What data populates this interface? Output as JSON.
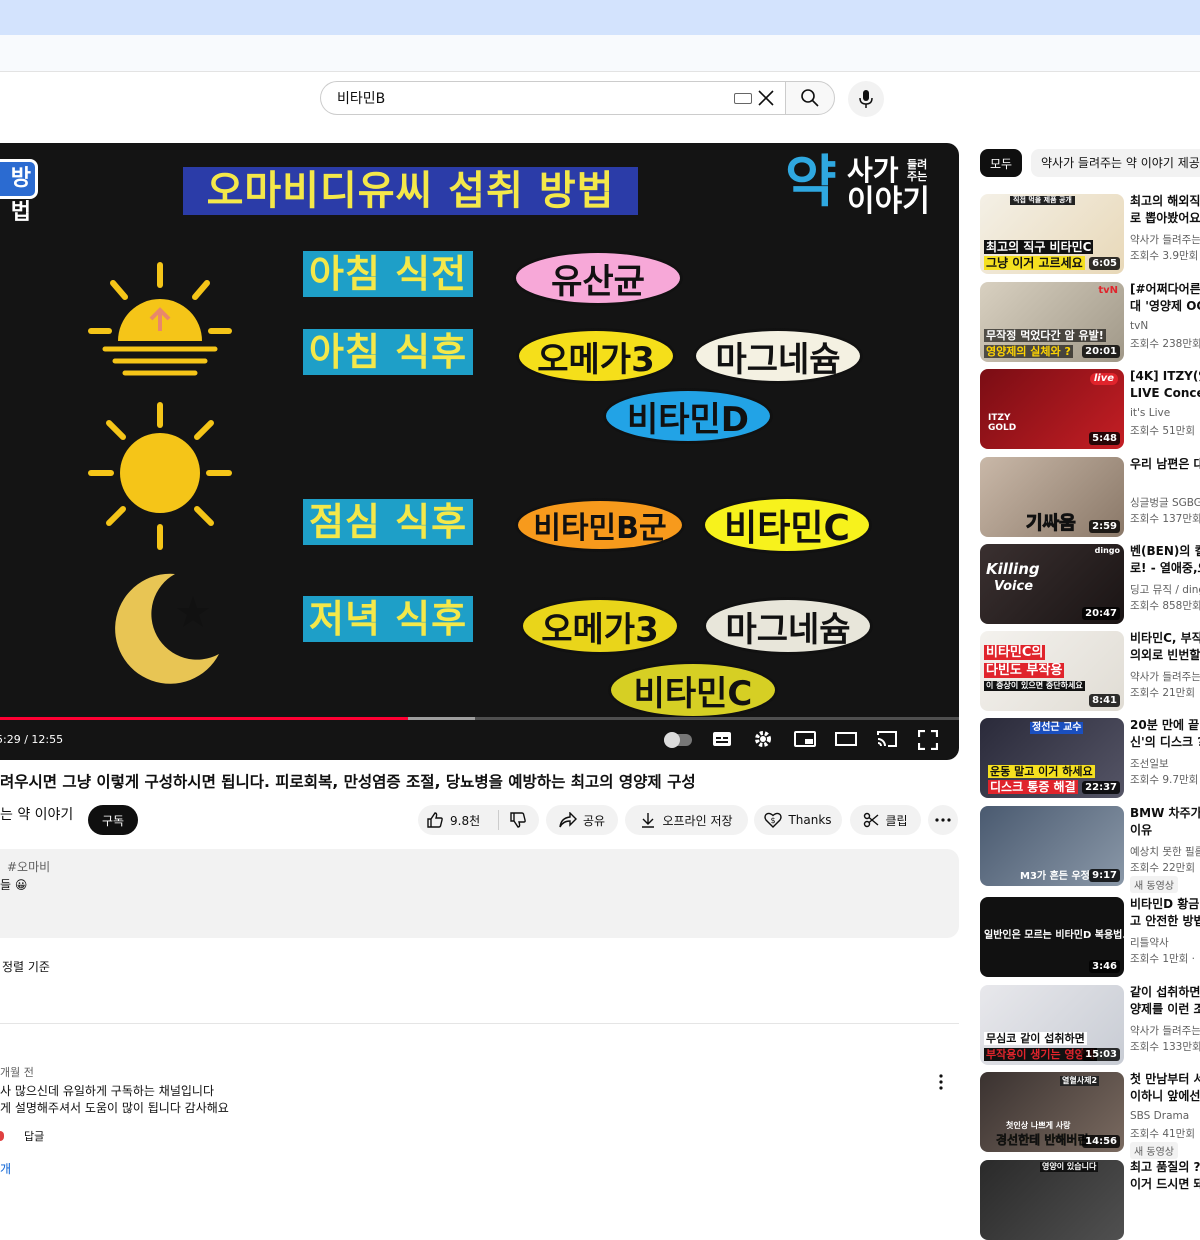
{
  "search": {
    "query": "비타민B"
  },
  "video": {
    "slide_title": "오마비디유씨 섭취 방법",
    "slide_corner": "방법",
    "logo_big": "약",
    "logo_line1": "사가",
    "logo_line1_small": "들려주는",
    "logo_line2": "이야기",
    "meals": [
      "아침 식전",
      "아침 식후",
      "점심 식후",
      "저녁 식후"
    ],
    "pills": {
      "probiotic": "유산균",
      "omega_1": "오메가3",
      "magnesium_1": "마그네슘",
      "vitamin_d": "비타민D",
      "vitamin_b": "비타민B군",
      "vitamin_c_1": "비타민C",
      "omega_2": "오메가3",
      "magnesium_2": "마그네슘",
      "vitamin_c_2": "비타민C"
    },
    "time_display": "5:29 / 12:55",
    "progress_fraction": 0.425,
    "buffered_fraction": 0.495,
    "colors": {
      "probiotic": "#f7a8d8",
      "omega": "#f5df1a",
      "magnesium": "#f4f1e2",
      "vitamin_d": "#22a3e6",
      "vitamin_b": "#f79a1c",
      "vitamin_c": "#f7f21c",
      "omega_evening": "#e9d51a",
      "magnesium_evening": "#e8e6da",
      "vitamin_c_evening": "#d6cf24",
      "accent_red": "#ff0033"
    }
  },
  "title": "려우시면 그냥 이렇게 구성하시면 됩니다. 피로회복, 만성염증 조절, 당뇨병을 예방하는 최고의 영양제 구성",
  "channel": {
    "name": "는 약 이야기",
    "subscribe_label": "구독"
  },
  "actions": {
    "like_count": "9.8천",
    "share_label": "공유",
    "download_label": "오프라인 저장",
    "thanks_label": "Thanks",
    "clip_label": "클립"
  },
  "description": {
    "hashtag": "#오마비",
    "line": "들 😀"
  },
  "comments": {
    "sort_label": "정렬 기준",
    "item": {
      "time": "개월 전",
      "line1": "사 많으신데 유일하게 구독하는 채널입니다",
      "line2": "게 설명해주셔서 도움이 많이 됩니다 감사해요",
      "reply_label": "답글",
      "replies_count": "개"
    }
  },
  "sidebar": {
    "chip_all": "모두",
    "chip_channel": "약사가 들려주는 약 이야기 제공",
    "recommendations": [
      {
        "title1": "최고의 해외직",
        "title2": "로 뽑아봤어요",
        "channel": "약사가 들려주는",
        "views": "조회수 3.9만회",
        "duration": "6:05",
        "thumb_text1": "최고의 직구 비타민C",
        "thumb_text2": "그냥 이거 고르세요",
        "thumb_top": "직접 먹을 제품 공개"
      },
      {
        "title1": "[#어쩌다어른",
        "title2": "대 '영양제 OO",
        "channel": "tvN",
        "views": "조회수 238만회",
        "duration": "20:01",
        "thumb_text1": "무작정 먹었다간 암 유발!",
        "thumb_text2": "영양제의 실체와 ?",
        "thumb_top": "tvN"
      },
      {
        "title1": "[4K] ITZY(있지",
        "title2": "LIVE Concert",
        "channel": "it's Live",
        "views": "조회수 51만회",
        "duration": "5:48",
        "thumb_text1": "ITZY",
        "thumb_text2": "GOLD",
        "thumb_top": "live"
      },
      {
        "title1": "우리 남편은 대",
        "title2": "",
        "channel": "싱글벙글 SGBG",
        "views": "조회수 137만회",
        "duration": "2:59",
        "thumb_text1": "기싸움",
        "thumb_text2": "",
        "thumb_top": ""
      },
      {
        "title1": "벤(BEN)의 킬",
        "title2": "로! - 열애중,오",
        "channel": "딩고 뮤직 / dingo",
        "views": "조회수 858만회",
        "duration": "20:47",
        "thumb_text1": "Killing",
        "thumb_text2": "Voice",
        "thumb_top": "dingo"
      },
      {
        "title1": "비타민C, 부작",
        "title2": "의외로 빈번할",
        "channel": "약사가 들려주는",
        "views": "조회수 21만회",
        "duration": "8:41",
        "thumb_text1": "비타민C의",
        "thumb_text2": "다빈도 부작용",
        "thumb_top": "이 증상이 있으면 중단하세요"
      },
      {
        "title1": "20분 만에 끝",
        "title2": "신'의 디스크 ?",
        "channel": "조선일보",
        "views": "조회수 9.7만회",
        "duration": "22:37",
        "thumb_text1": "운동 말고 이거 하세요",
        "thumb_text2": "디스크 통증 해결",
        "thumb_top": "정선근 교수"
      },
      {
        "title1": "BMW 차주가",
        "title2": "이유",
        "channel": "예상치 못한 필름",
        "views": "조회수 22만회",
        "duration": "9:17",
        "new": "새 동영상",
        "thumb_text1": "M3가 흔든 우정",
        "thumb_text2": "",
        "thumb_top": ""
      },
      {
        "title1": "비타민D 황금",
        "title2": "고 안전한 방법",
        "channel": "리틀약사",
        "views": "조회수 1만회 ·",
        "duration": "3:46",
        "thumb_text1": "일반인은 모르는 비타민D 복용법...",
        "thumb_text2": "",
        "thumb_top": ""
      },
      {
        "title1": "같이 섭취하면",
        "title2": "양제를 이런 조",
        "channel": "약사가 들려주는",
        "views": "조회수 133만회",
        "duration": "15:03",
        "thumb_text1": "무심코 같이 섭취하면",
        "thumb_text2": "부작용이 생기는 영양제",
        "thumb_top": ""
      },
      {
        "title1": "첫 만남부터 서",
        "title2": "이하니 앞에선",
        "channel": "SBS Drama",
        "views": "조회수 41만회",
        "duration": "14:56",
        "new": "새 동영상",
        "thumb_text1": "첫인상 나쁘게 사랑",
        "thumb_text2": "경선한테 반해버린",
        "thumb_top": "열혈사제2"
      },
      {
        "title1": "최고 품질의 ?",
        "title2": "이거 드시면 돼",
        "channel": "",
        "views": "",
        "duration": "",
        "thumb_text1": "",
        "thumb_text2": "",
        "thumb_top": "영양이 있습니다"
      }
    ]
  }
}
